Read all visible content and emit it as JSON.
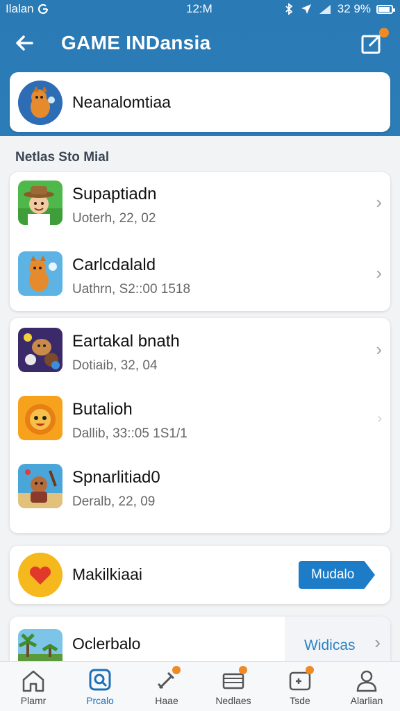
{
  "status_bar": {
    "carrier": "Ilalan",
    "time": "12:M",
    "battery": "32 9%",
    "battery_level": 0.9
  },
  "app_bar": {
    "title": "GAME INDansia"
  },
  "profile": {
    "name": "Neanalomtiaa"
  },
  "section": {
    "label": "Netlas Sto Mial"
  },
  "group1": [
    {
      "title": "Supaptiadn",
      "subtitle": "Uoterh, 22, 02"
    },
    {
      "title": "Carlcdalald",
      "subtitle": "Uathrn, S2::00 1518"
    }
  ],
  "group2": [
    {
      "title": "Eartakal bnath",
      "subtitle": "Dotiaib, 32, 04"
    },
    {
      "title": "Butalioh",
      "subtitle": "Dallib, 33::05 1S1/1"
    },
    {
      "title": "Spnarlitiad0",
      "subtitle": "Deralb, 22, 09"
    }
  ],
  "promo": {
    "title": "Makilkiaai",
    "button_label": "Mudalo"
  },
  "last": {
    "title": "Oclerbalo",
    "link_label": "Widicas"
  },
  "bottom_nav": [
    {
      "label": "Plamr",
      "icon": "home-icon"
    },
    {
      "label": "Prcalo",
      "icon": "search-icon"
    },
    {
      "label": "Haae",
      "icon": "sword-icon"
    },
    {
      "label": "Nedlaes",
      "icon": "stack-icon"
    },
    {
      "label": "Tsde",
      "icon": "controller-icon"
    },
    {
      "label": "Alarlian",
      "icon": "user-icon"
    }
  ],
  "colors": {
    "header": "#2a7ab6",
    "accent": "#1c7cc7",
    "badge": "#f08a24"
  }
}
